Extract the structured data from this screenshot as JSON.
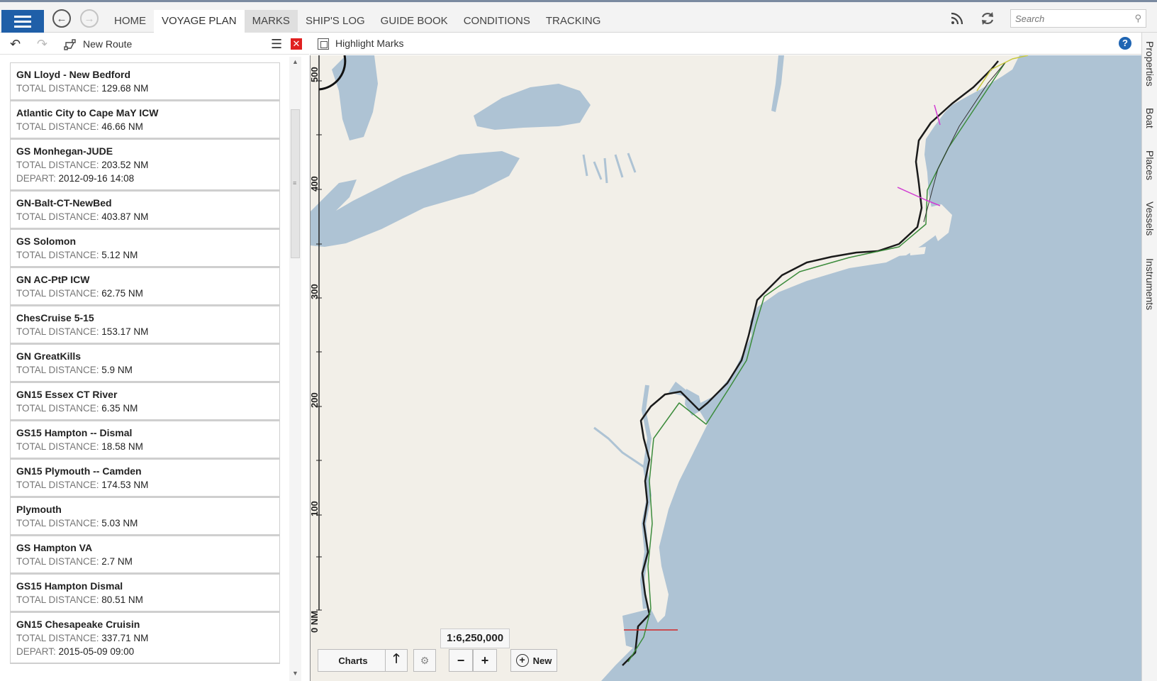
{
  "topnav": {
    "tabs": [
      {
        "label": "HOME"
      },
      {
        "label": "VOYAGE PLAN"
      },
      {
        "label": "MARKS"
      },
      {
        "label": "SHIP'S LOG"
      },
      {
        "label": "GUIDE BOOK"
      },
      {
        "label": "CONDITIONS"
      },
      {
        "label": "TRACKING"
      }
    ],
    "active_tab": "VOYAGE PLAN",
    "search_placeholder": "Search"
  },
  "left_toolbar": {
    "new_route_label": "New Route"
  },
  "routes": [
    {
      "name": "GN Lloyd - New Bedford",
      "distance_label": "TOTAL DISTANCE:",
      "distance": "129.68 NM"
    },
    {
      "name": "Atlantic City to Cape MaY ICW",
      "distance_label": "TOTAL DISTANCE:",
      "distance": "46.66 NM"
    },
    {
      "name": "GS Monhegan-JUDE",
      "distance_label": "TOTAL DISTANCE:",
      "distance": "203.52 NM",
      "depart_label": "DEPART:",
      "depart": "2012-09-16 14:08"
    },
    {
      "name": "GN-Balt-CT-NewBed",
      "distance_label": "TOTAL DISTANCE:",
      "distance": "403.87 NM"
    },
    {
      "name": "GS Solomon",
      "distance_label": "TOTAL DISTANCE:",
      "distance": "5.12 NM"
    },
    {
      "name": "GN AC-PtP ICW",
      "distance_label": "TOTAL DISTANCE:",
      "distance": "62.75 NM"
    },
    {
      "name": "ChesCruise 5-15",
      "distance_label": "TOTAL DISTANCE:",
      "distance": "153.17 NM"
    },
    {
      "name": "GN GreatKills",
      "distance_label": "TOTAL DISTANCE:",
      "distance": "5.9 NM"
    },
    {
      "name": "GN15 Essex CT River",
      "distance_label": "TOTAL DISTANCE:",
      "distance": "6.35 NM"
    },
    {
      "name": "GS15 Hampton -- Dismal",
      "distance_label": "TOTAL DISTANCE:",
      "distance": "18.58 NM"
    },
    {
      "name": "GN15 Plymouth -- Camden",
      "distance_label": "TOTAL DISTANCE:",
      "distance": "174.53 NM"
    },
    {
      "name": "Plymouth",
      "distance_label": "TOTAL DISTANCE:",
      "distance": "5.03 NM"
    },
    {
      "name": "GS Hampton VA",
      "distance_label": "TOTAL DISTANCE:",
      "distance": "2.7 NM"
    },
    {
      "name": "GS15 Hampton Dismal",
      "distance_label": "TOTAL DISTANCE:",
      "distance": "80.51 NM"
    },
    {
      "name": "GN15 Chesapeake Cruisin",
      "distance_label": "TOTAL DISTANCE:",
      "distance": "337.71 NM",
      "depart_label": "DEPART:",
      "depart": "2015-05-09 09:00"
    }
  ],
  "map_toolbar": {
    "highlight_label": "Highlight Marks",
    "help_label": "?"
  },
  "map": {
    "scale_ratio": "1:6,250,000",
    "scale_labels": [
      "500",
      "400",
      "300",
      "200",
      "100",
      "0 NM"
    ],
    "charts_label": "Charts",
    "new_label": "New",
    "zoom_out": "−",
    "zoom_in": "+"
  },
  "side_tabs": [
    "Properties",
    "Boat",
    "Places",
    "Vessels",
    "Instruments"
  ],
  "colors": {
    "menu_blue": "#1f5fa8",
    "land": "#f2efe8",
    "water": "#aec3d4",
    "route_green": "#3c8c3c",
    "route_magenta": "#d23cd2",
    "close_red": "#e02020"
  }
}
